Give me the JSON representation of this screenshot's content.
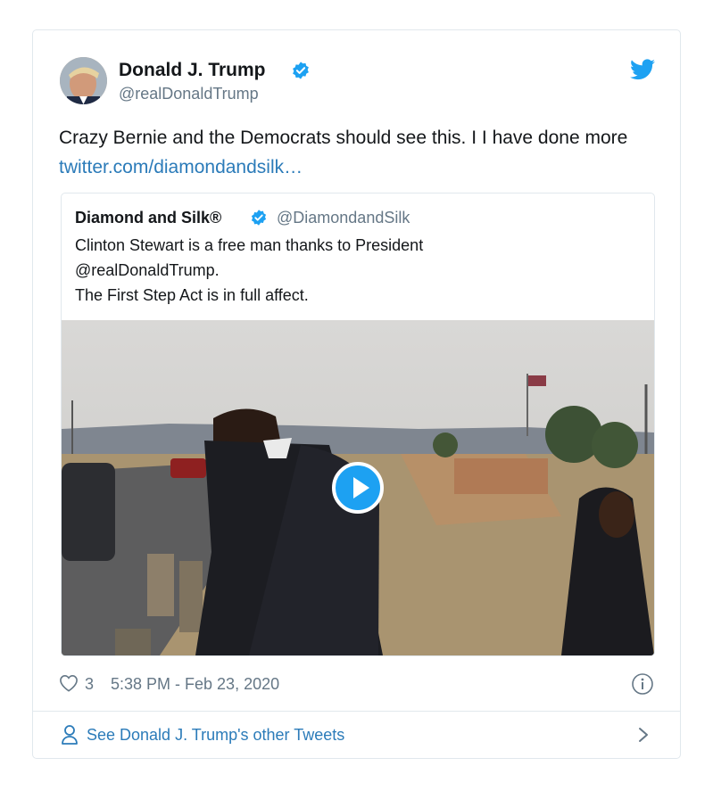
{
  "author": {
    "name": "Donald J. Trump",
    "handle": "@realDonaldTrump"
  },
  "tweet": {
    "text": "Crazy Bernie and the Democrats should see this. I I have done more",
    "link": "twitter.com/diamondandsilk…"
  },
  "quoted": {
    "name": "Diamond and Silk®",
    "handle": "@DiamondandSilk",
    "lines": [
      "Clinton Stewart is a free man thanks to President",
      "@realDonaldTrump.",
      "The First Step Act is in full affect."
    ]
  },
  "meta": {
    "likes": "3",
    "timestamp": "5:38 PM - Feb 23, 2020"
  },
  "footer": {
    "label": "See Donald J. Trump's other Tweets"
  },
  "colors": {
    "link": "#2b7bb9",
    "verified": "#1da1f2",
    "text_secondary": "#657786",
    "border": "#e1e8ed"
  },
  "icons": [
    "verified-badge-icon",
    "twitter-bird-icon",
    "play-icon",
    "heart-icon",
    "info-icon",
    "person-icon",
    "chevron-right-icon"
  ]
}
